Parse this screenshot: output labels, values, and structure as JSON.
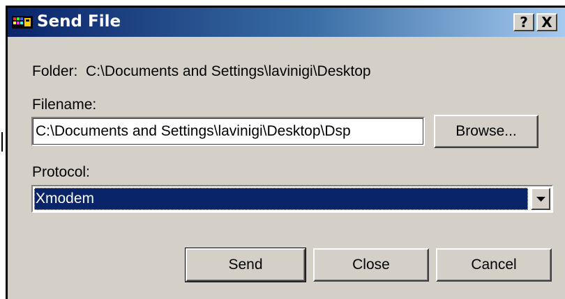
{
  "window": {
    "title": "Send File",
    "help_button": "?",
    "close_button": "X"
  },
  "folder": {
    "label": "Folder:",
    "path": "C:\\Documents and Settings\\lavinigi\\Desktop"
  },
  "filename": {
    "label": "Filename:",
    "value": "C:\\Documents and Settings\\lavinigi\\Desktop\\Dsp",
    "browse_label": "Browse..."
  },
  "protocol": {
    "label": "Protocol:",
    "selected": "Xmodem"
  },
  "buttons": {
    "send": "Send",
    "close": "Close",
    "cancel": "Cancel"
  },
  "icons": {
    "app": "terminal-app-icon",
    "dropdown": "chevron-down-icon"
  },
  "colors": {
    "titlebar_start": "#0a246a",
    "titlebar_end": "#a6caf0",
    "dialog_bg": "#d4d0c8",
    "selection_bg": "#0a246a"
  }
}
